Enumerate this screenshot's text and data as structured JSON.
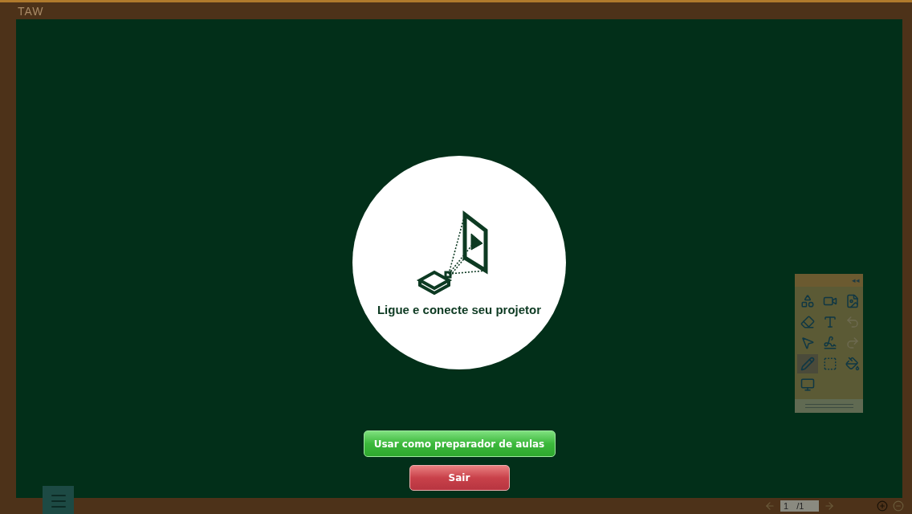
{
  "window": {
    "title": "TAW"
  },
  "prompt": {
    "message": "Ligue e conecte seu projetor"
  },
  "buttons": [
    {
      "label": "Usar como preparador de aulas",
      "kind": "primary"
    },
    {
      "label": "Sair",
      "kind": "danger"
    }
  ],
  "toolbox": {
    "collapse": "◂◂",
    "tools": [
      {
        "kind": "shapes",
        "selected": false,
        "disabled": false
      },
      {
        "kind": "media",
        "selected": false,
        "disabled": false
      },
      {
        "kind": "image",
        "selected": false,
        "disabled": false
      },
      {
        "kind": "eraser",
        "selected": false,
        "disabled": false
      },
      {
        "kind": "text",
        "selected": false,
        "disabled": false
      },
      {
        "kind": "undo",
        "selected": false,
        "disabled": true
      },
      {
        "kind": "pointer",
        "selected": false,
        "disabled": false
      },
      {
        "kind": "freehand",
        "selected": false,
        "disabled": false
      },
      {
        "kind": "redo",
        "selected": false,
        "disabled": true
      },
      {
        "kind": "pen",
        "selected": true,
        "disabled": false
      },
      {
        "kind": "select",
        "selected": false,
        "disabled": false
      },
      {
        "kind": "fill",
        "selected": false,
        "disabled": false
      },
      {
        "kind": "screen",
        "selected": false,
        "disabled": false
      }
    ]
  },
  "pager": {
    "page": "1",
    "total": "/1"
  }
}
